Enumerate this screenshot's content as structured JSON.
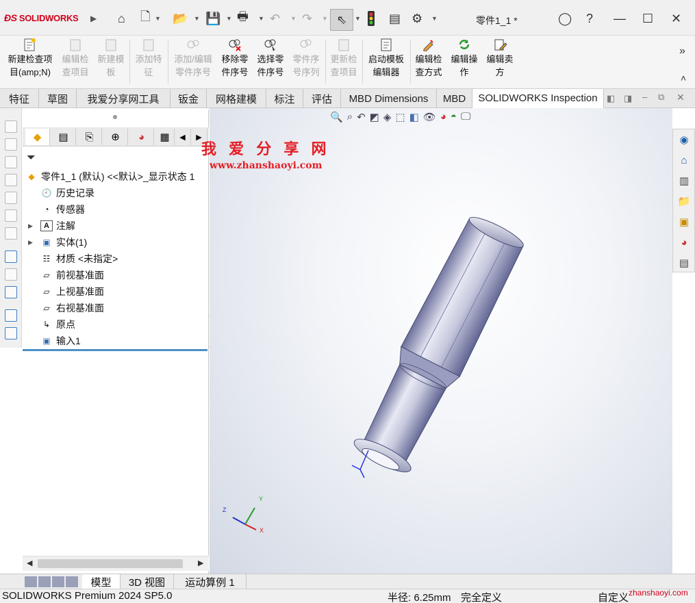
{
  "app": {
    "logo": "SOLIDWORKS",
    "document_title": "零件1_1 *"
  },
  "ribbon": {
    "buttons": [
      {
        "label": "新建检查项\n目(amp;N)",
        "line1": "新建检查项",
        "line2": "目(amp;N)",
        "enabled": true
      },
      {
        "line1": "编辑检",
        "line2": "查项目",
        "enabled": false
      },
      {
        "line1": "新建模",
        "line2": "板",
        "enabled": false
      },
      {
        "line1": "添加特",
        "line2": "征",
        "enabled": false
      },
      {
        "line1": "添加/编辑",
        "line2": "零件序号",
        "enabled": false
      },
      {
        "line1": "移除零",
        "line2": "件序号",
        "enabled": true
      },
      {
        "line1": "选择零",
        "line2": "件序号",
        "enabled": true
      },
      {
        "line1": "零件序",
        "line2": "号序列",
        "enabled": false
      },
      {
        "line1": "更新检",
        "line2": "查项目",
        "enabled": false
      },
      {
        "line1": "启动模板",
        "line2": "编辑器",
        "enabled": true
      },
      {
        "line1": "编辑检",
        "line2": "查方式",
        "enabled": true
      },
      {
        "line1": "编辑操",
        "line2": "作",
        "enabled": true
      },
      {
        "line1": "编辑卖",
        "line2": "方",
        "enabled": true
      }
    ],
    "more": "»",
    "collapse": "˄"
  },
  "tabs": [
    "特征",
    "草图",
    "我爱分享网工具",
    "钣金",
    "网格建模",
    "标注",
    "评估",
    "MBD Dimensions",
    "MBD",
    "SOLIDWORKS Inspection"
  ],
  "active_tab": "SOLIDWORKS Inspection",
  "tree": {
    "root": "零件1_1 (默认) <<默认>_显示状态 1",
    "items": [
      "历史记录",
      "传感器",
      "注解",
      "实体(1)",
      "材质 <未指定>",
      "前视基准面",
      "上视基准面",
      "右视基准面",
      "原点",
      "输入1"
    ]
  },
  "watermark": {
    "line1": "我 爱 分 享 网",
    "line2": "www.zhanshaoyi.com"
  },
  "triad": {
    "x": "X",
    "y": "Y",
    "z": "Z"
  },
  "bottom_tabs": [
    "模型",
    "3D 视图",
    "运动算例 1"
  ],
  "status": {
    "product": "SOLIDWORKS Premium 2024 SP5.0",
    "radius": "半径: 6.25mm",
    "state": "完全定义",
    "custom": "自定义",
    "site": "zhanshaoyi.com"
  }
}
